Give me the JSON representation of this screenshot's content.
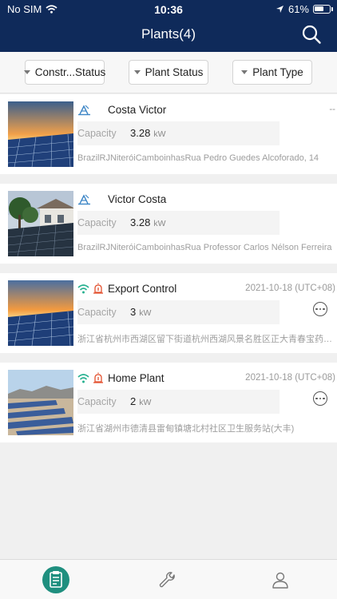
{
  "status_bar": {
    "carrier": "No SIM",
    "time": "10:36",
    "battery": "61%"
  },
  "header": {
    "title": "Plants(4)"
  },
  "filters": [
    {
      "label": "Constr...Status"
    },
    {
      "label": "Plant Status"
    },
    {
      "label": "Plant Type"
    }
  ],
  "plants": [
    {
      "name": "Costa Victor",
      "date": "--",
      "capacity_label": "Capacity",
      "capacity": "3.28",
      "unit": "kW",
      "address": "BrazilRJNiteróiCamboinhasRua Pedro Guedes Alcoforado, 14",
      "status_icons": [
        "construction-icon"
      ],
      "has_more": false
    },
    {
      "name": "Victor Costa",
      "date": "",
      "capacity_label": "Capacity",
      "capacity": "3.28",
      "unit": "kW",
      "address": "BrazilRJNiteróiCamboinhasRua Professor Carlos Nélson Ferreira",
      "status_icons": [
        "construction-icon"
      ],
      "has_more": false
    },
    {
      "name": "Export Control",
      "date": "2021-10-18  (UTC+08)",
      "capacity_label": "Capacity",
      "capacity": "3",
      "unit": "kW",
      "address": "浙江省杭州市西湖区留下街道杭州西湖风景名胜区正大青春宝药业有限公司",
      "status_icons": [
        "wifi-icon",
        "alarm-icon"
      ],
      "has_more": true
    },
    {
      "name": "Home Plant",
      "date": "2021-10-18  (UTC+08)",
      "capacity_label": "Capacity",
      "capacity": "2",
      "unit": "kW",
      "address": "浙江省湖州市德清县雷甸镇塘北村社区卫生服务站(大丰)",
      "status_icons": [
        "wifi-icon",
        "alarm-icon"
      ],
      "has_more": true
    }
  ],
  "tabs": [
    {
      "icon": "plant-list-icon",
      "active": true
    },
    {
      "icon": "wrench-icon",
      "active": false
    },
    {
      "icon": "user-icon",
      "active": false
    }
  ],
  "colors": {
    "header": "#0f2a5a",
    "tab_active": "#1f8f7f",
    "wifi": "#25b08f",
    "alarm": "#e3512f",
    "construction": "#3d86c6"
  }
}
